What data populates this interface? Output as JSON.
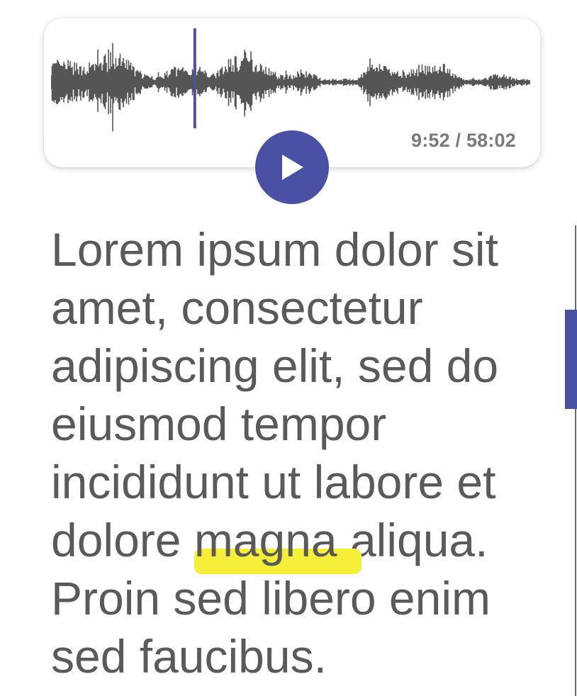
{
  "player": {
    "current_time": "9:52",
    "total_time": "58:02",
    "time_separator": " / ",
    "progress_fraction": 0.3,
    "play_icon": "play-icon",
    "accent_color": "#4a50a4",
    "waveform_color": "#555555"
  },
  "transcript": {
    "text_before": "Lorem ipsum dolor sit amet, consectetur adipiscing elit, sed do eiusmod tempor incididunt ut labore et dolore ",
    "highlighted_word": "magna",
    "text_after": " aliqua. Proin sed libero enim sed faucibus.",
    "highlight_color": "#f6ef3a",
    "text_color": "#5a5a5a"
  },
  "scrollbar": {
    "thumb_color": "#4a50a4"
  }
}
